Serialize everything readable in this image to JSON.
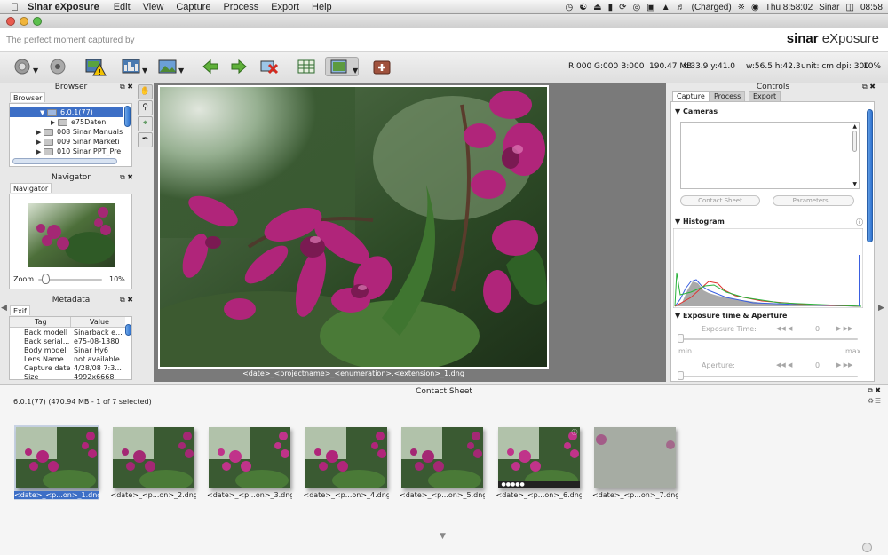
{
  "menubar": {
    "app_name": "Sinar eXposure",
    "items": [
      "Edit",
      "View",
      "Capture",
      "Process",
      "Export",
      "Help"
    ],
    "charged": "(Charged)",
    "clock": "Thu 8:58:02",
    "user": "Sinar",
    "time": "08:58"
  },
  "brand": {
    "tagline": "The perfect moment captured by",
    "logo_bold": "sinar",
    "logo_text": "eXposure"
  },
  "toolbar": {
    "status": {
      "rgb": "R:000 G:000 B:000",
      "size": "190.47 MB",
      "coords": "x:33.9 y:41.0",
      "dims": "w:56.5 h:42.3",
      "units": "unit: cm dpi: 300",
      "zoom": "10%"
    }
  },
  "browser": {
    "title": "Browser",
    "tab": "Browser",
    "rows": [
      {
        "label": "6.0.1(77)",
        "expanded": true,
        "selected": true
      },
      {
        "label": "e75Daten",
        "expanded": false
      },
      {
        "label": "008 Sinar Manuals",
        "expanded": false
      },
      {
        "label": "009 Sinar Marketi",
        "expanded": false
      },
      {
        "label": "010 Sinar PPT_Pre",
        "expanded": false
      }
    ]
  },
  "navigator": {
    "title": "Navigator",
    "tab": "Navigator",
    "zoom_label": "Zoom",
    "zoom_value": "10%",
    "zoom_level": 0.1
  },
  "metadata": {
    "title": "Metadata",
    "tab": "Exif",
    "col_tag": "Tag",
    "col_value": "Value",
    "rows": [
      {
        "tag": "Back modell",
        "value": "Sinarback e..."
      },
      {
        "tag": "Back serial...",
        "value": "e75-08-1380"
      },
      {
        "tag": "Body model",
        "value": "Sinar Hy6"
      },
      {
        "tag": "Lens Name",
        "value": "not available"
      },
      {
        "tag": "Capture date",
        "value": "4/28/08 7:3..."
      },
      {
        "tag": "Size",
        "value": "4992x6668"
      }
    ]
  },
  "viewer": {
    "caption": "<date>_<projectname>_<enumeration>.<extension>_1.dng"
  },
  "controls": {
    "title": "Controls",
    "tabs": [
      "Capture",
      "Process",
      "Export"
    ],
    "cameras_label": "Cameras",
    "contact_sheet_btn": "Contact Sheet",
    "parameters_btn": "Parameters...",
    "histogram_label": "Histogram",
    "exposure_label": "Exposure time & Aperture",
    "exposure_time_label": "Exposure Time:",
    "exposure_time_value": "0",
    "min_label": "min",
    "max_label": "max",
    "aperture_label": "Aperture:",
    "aperture_value": "0"
  },
  "contact_sheet": {
    "title": "Contact Sheet",
    "info": "6.0.1(77) (470.94 MB - 1 of 7 selected)",
    "thumbs": [
      "<date>_<p...on>_1.dng",
      "<date>_<p...on>_2.dng",
      "<date>_<p...on>_3.dng",
      "<date>_<p...on>_4.dng",
      "<date>_<p...on>_5.dng",
      "<date>_<p...on>_6.dng",
      "<date>_<p...on>_7.dng"
    ]
  },
  "colors": {
    "selection": "#3d6fc6",
    "orchid": "#b0257a",
    "leaf": "#3f6e2e",
    "viewer_bg": "#7a7a7a"
  }
}
